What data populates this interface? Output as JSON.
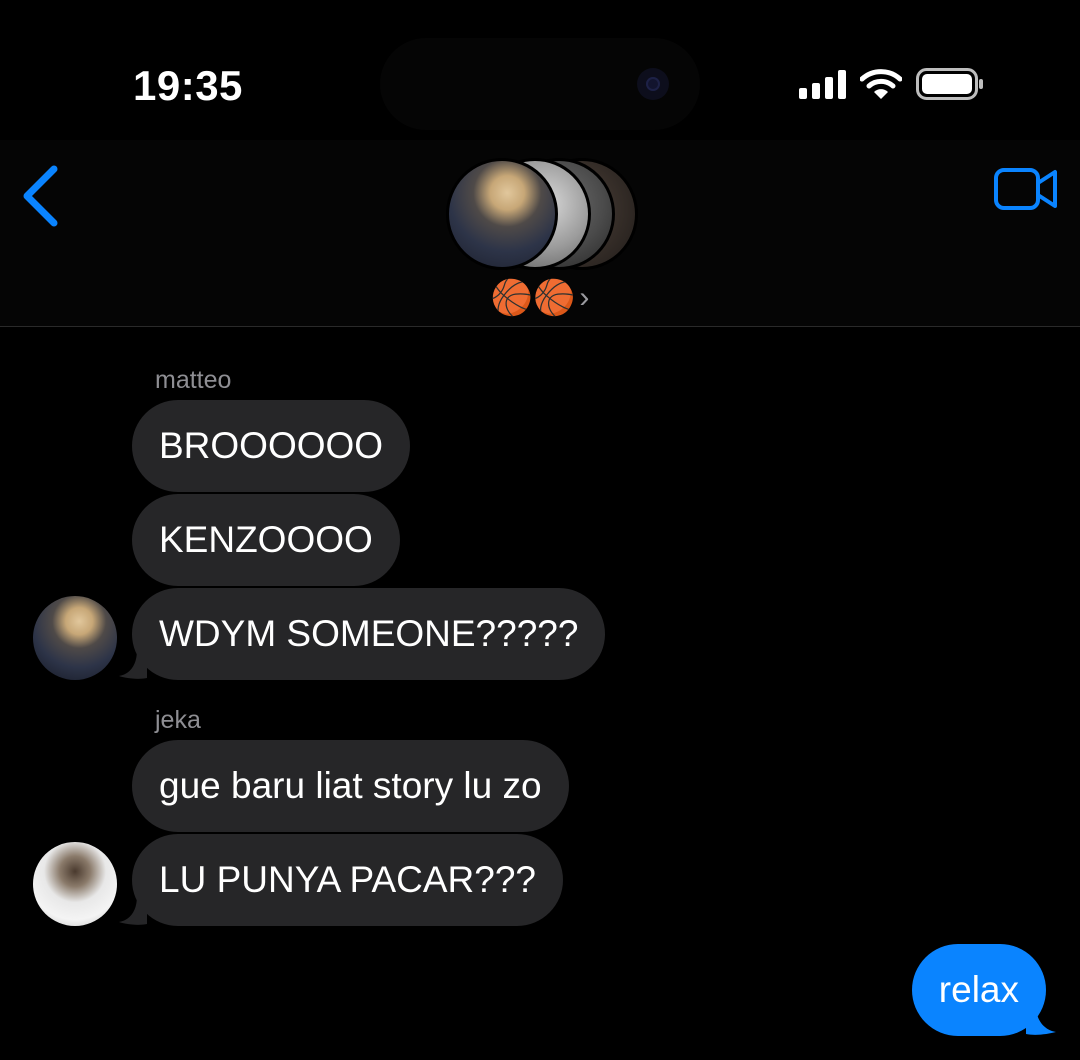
{
  "status_bar": {
    "time": "19:35"
  },
  "header": {
    "group_name": "🏀🏀",
    "chevron": "›"
  },
  "colors": {
    "incoming_bubble": "#262628",
    "outgoing_bubble": "#0a84ff",
    "accent": "#0a84ff",
    "sender_text": "#8e8e93"
  },
  "icons": {
    "back": "chevron-left-icon",
    "video": "video-camera-icon"
  },
  "messages": [
    {
      "sender": "matteo",
      "text": "BROOOOOO"
    },
    {
      "sender": "matteo",
      "text": "KENZOOOO"
    },
    {
      "sender": "matteo",
      "text": "WDYM SOMEONE?????"
    },
    {
      "sender": "jeka",
      "text": "gue baru liat story lu zo"
    },
    {
      "sender": "jeka",
      "text": "LU PUNYA PACAR???"
    },
    {
      "sender": "me",
      "text": "relax"
    }
  ]
}
